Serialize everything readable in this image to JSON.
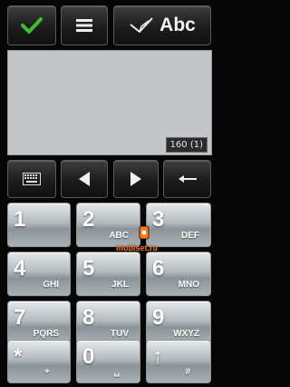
{
  "top_bar": {
    "confirm_icon": "checkmark-icon",
    "menu_icon": "menu-lines-icon",
    "mode_icon": "pen-icon",
    "mode_label": "Abc",
    "accent_check": "#3bbf2a"
  },
  "editor": {
    "text": "",
    "counter": "160 (1)"
  },
  "controls": {
    "keyboard_icon": "keyboard-icon",
    "left_icon": "left-arrow-icon",
    "right_icon": "right-arrow-icon",
    "backspace_icon": "backspace-arrow-icon"
  },
  "keypad": [
    {
      "num": "1",
      "letters": ""
    },
    {
      "num": "2",
      "letters": "ABC"
    },
    {
      "num": "3",
      "letters": "DEF"
    },
    {
      "num": "4",
      "letters": "GHI"
    },
    {
      "num": "5",
      "letters": "JKL"
    },
    {
      "num": "6",
      "letters": "MNO"
    },
    {
      "num": "7",
      "letters": "PQRS"
    },
    {
      "num": "8",
      "letters": "TUV"
    },
    {
      "num": "9",
      "letters": "WXYZ"
    },
    {
      "num": "*",
      "letters": "+"
    },
    {
      "num": "0",
      "letters": "␣"
    },
    {
      "num": "↑",
      "letters": "#"
    }
  ],
  "watermark": "mobiset.ru"
}
